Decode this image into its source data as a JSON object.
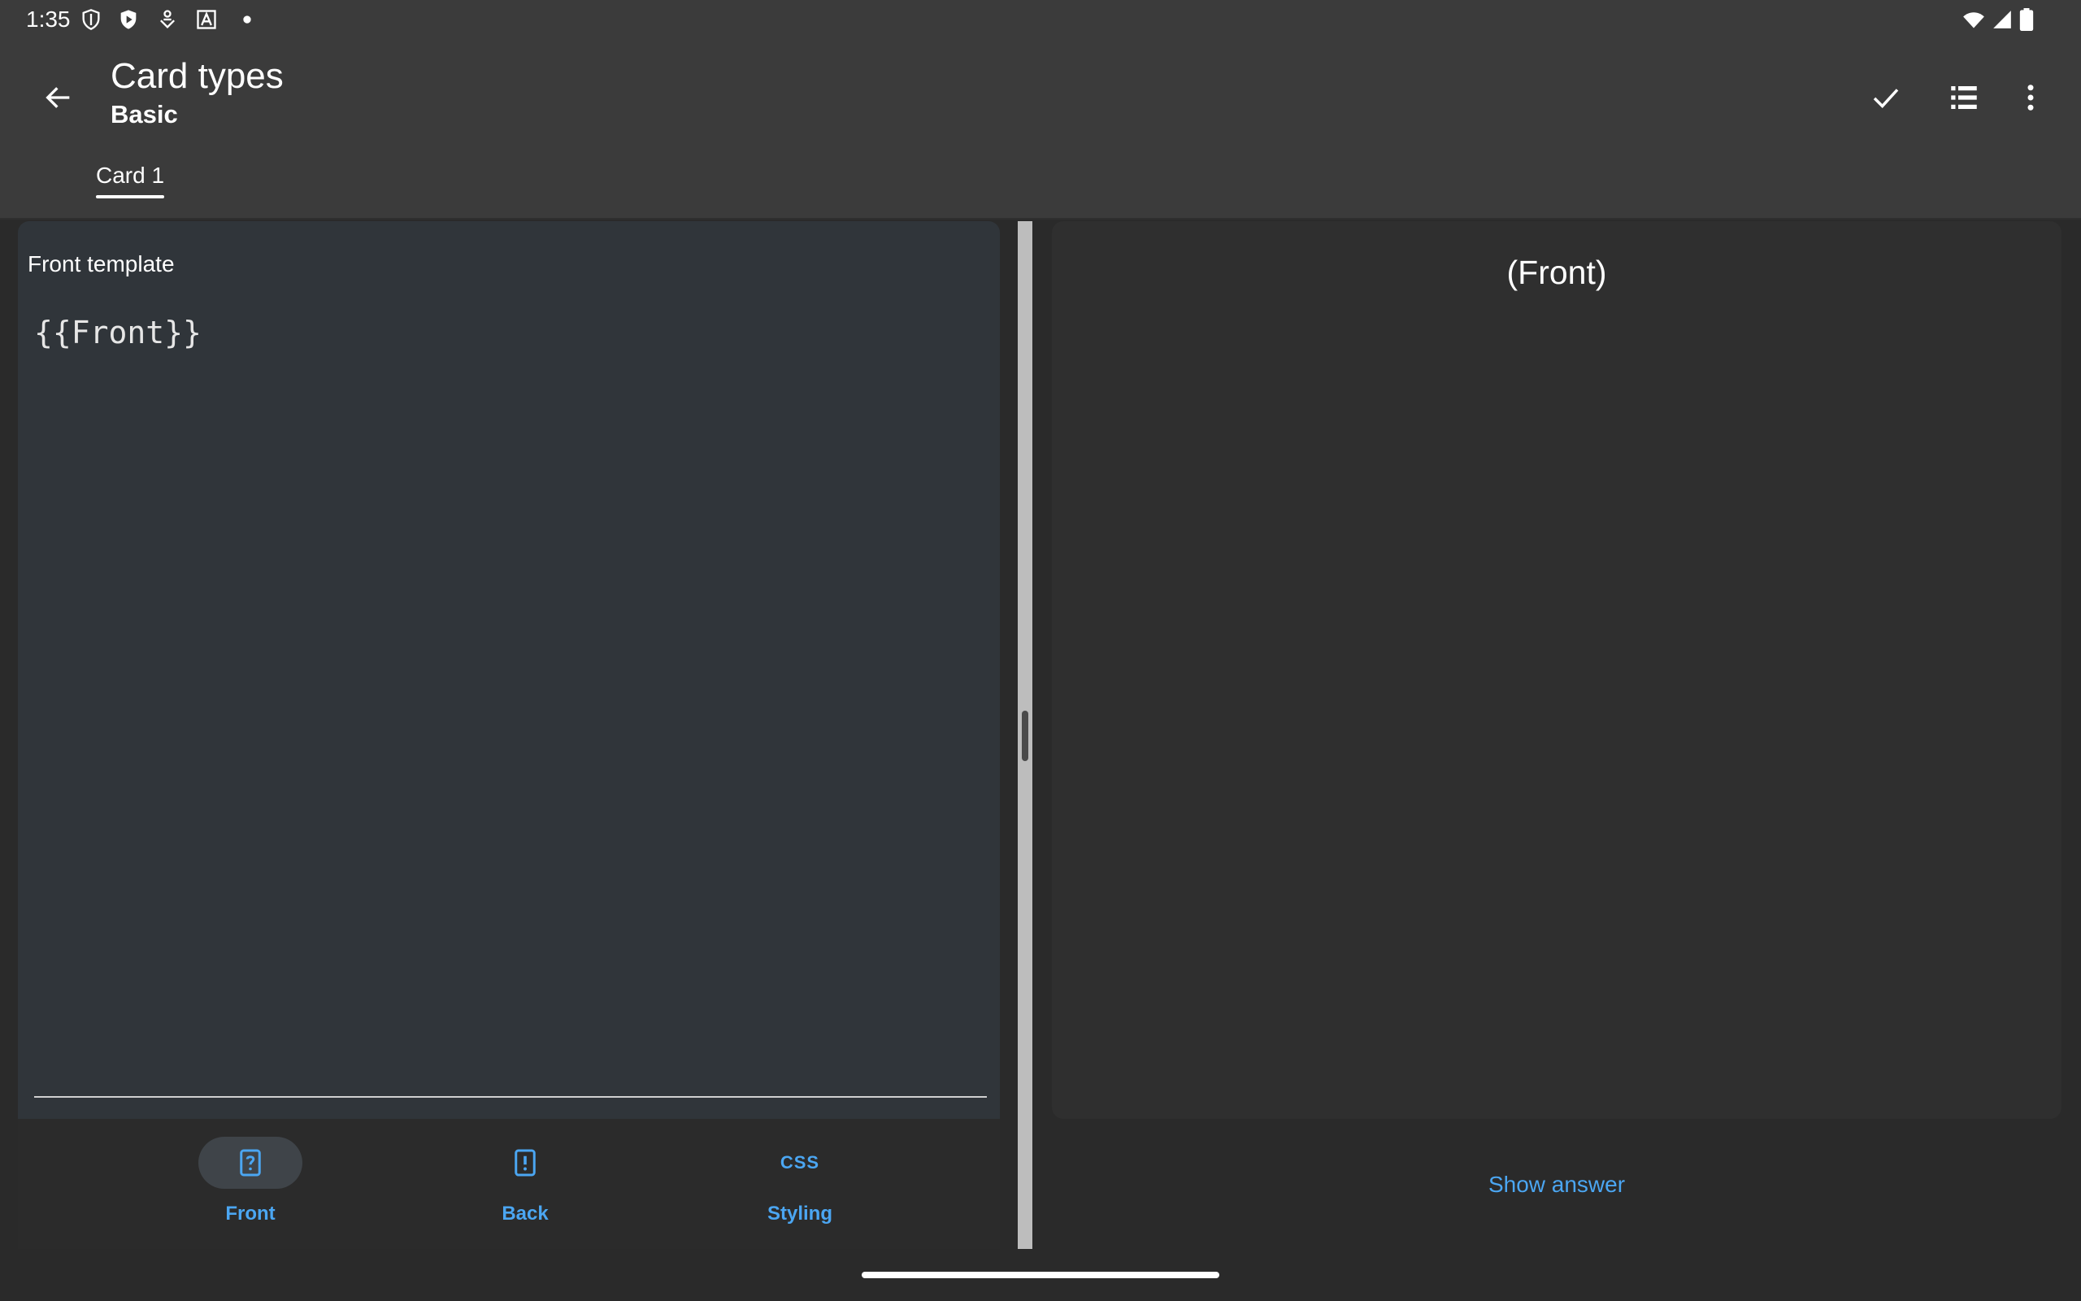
{
  "status_bar": {
    "time": "1:35",
    "icons": [
      "shield-outline-icon",
      "shield-play-icon",
      "download-person-icon",
      "font-a-icon",
      "dot-icon",
      "wifi-icon",
      "cell-signal-icon",
      "battery-icon"
    ]
  },
  "app_bar": {
    "title": "Card types",
    "subtitle": "Basic",
    "actions": [
      "check-icon",
      "list-icon",
      "more-vert-icon"
    ]
  },
  "tabs": [
    {
      "label": "Card 1",
      "selected": true
    }
  ],
  "editor": {
    "label": "Front template",
    "content": "{{Front}}"
  },
  "bottom_nav": {
    "items": [
      {
        "label": "Front",
        "icon": "card-question-icon",
        "selected": true
      },
      {
        "label": "Back",
        "icon": "card-exclamation-icon",
        "selected": false
      },
      {
        "label": "Styling",
        "icon": "css-icon",
        "glyph": "CSS",
        "selected": false
      }
    ]
  },
  "preview": {
    "text": "(Front)",
    "show_answer_label": "Show answer"
  },
  "colors": {
    "accent": "#4ba6f2",
    "app_bar": "#3b3b3b",
    "editor_bg": "#30353a",
    "preview_bg": "#2f2f2f"
  }
}
